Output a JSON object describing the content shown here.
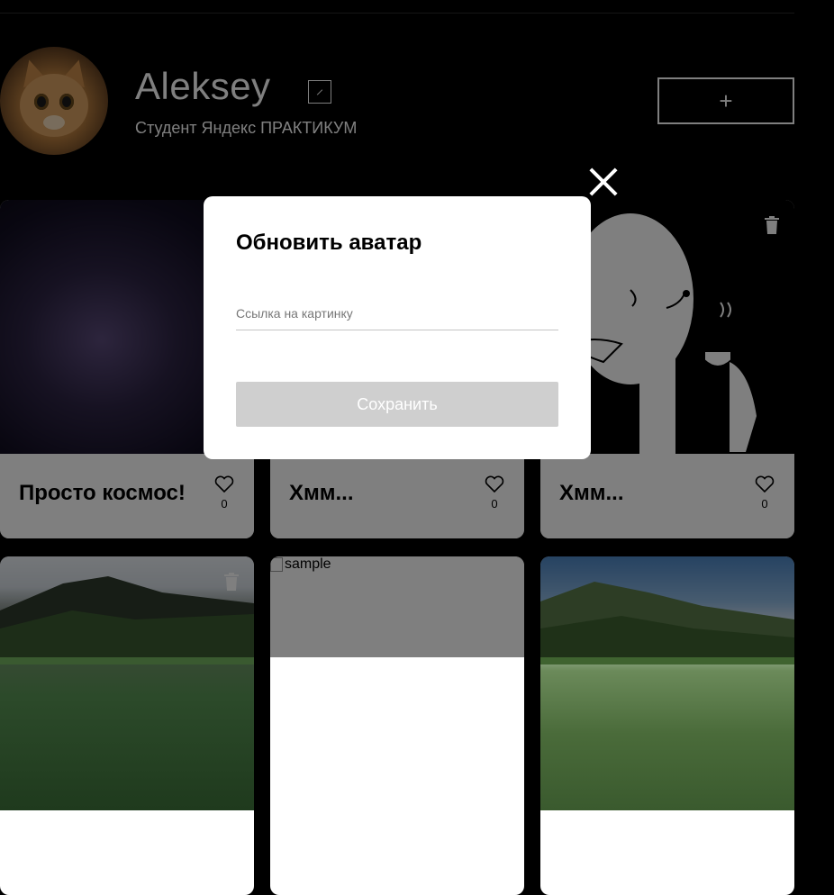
{
  "profile": {
    "name": "Aleksey",
    "about": "Студент Яндекс ПРАКТИКУМ",
    "add_label": "+"
  },
  "cards": [
    {
      "title": "Просто космос!",
      "likes": "0",
      "has_trash": false
    },
    {
      "title": "Хмм...",
      "likes": "0",
      "has_trash": false
    },
    {
      "title": "Хмм...",
      "likes": "0",
      "has_trash": true
    },
    {
      "title": "",
      "likes": "",
      "has_trash": true
    },
    {
      "title": "",
      "likes": "",
      "alt": "sample",
      "has_trash": false
    },
    {
      "title": "",
      "likes": "",
      "has_trash": false
    }
  ],
  "modal": {
    "title": "Обновить аватар",
    "input_placeholder": "Ссылка на картинку",
    "input_value": "",
    "save_label": "Сохранить"
  },
  "icons": {
    "close": "close-icon",
    "edit": "pencil-icon",
    "like": "heart-icon",
    "trash": "trash-icon"
  },
  "colors": {
    "page_bg": "#000000",
    "card_bg": "#ffffff",
    "save_disabled": "#cfcfcf",
    "overlay": "rgba(0,0,0,0.5)"
  }
}
